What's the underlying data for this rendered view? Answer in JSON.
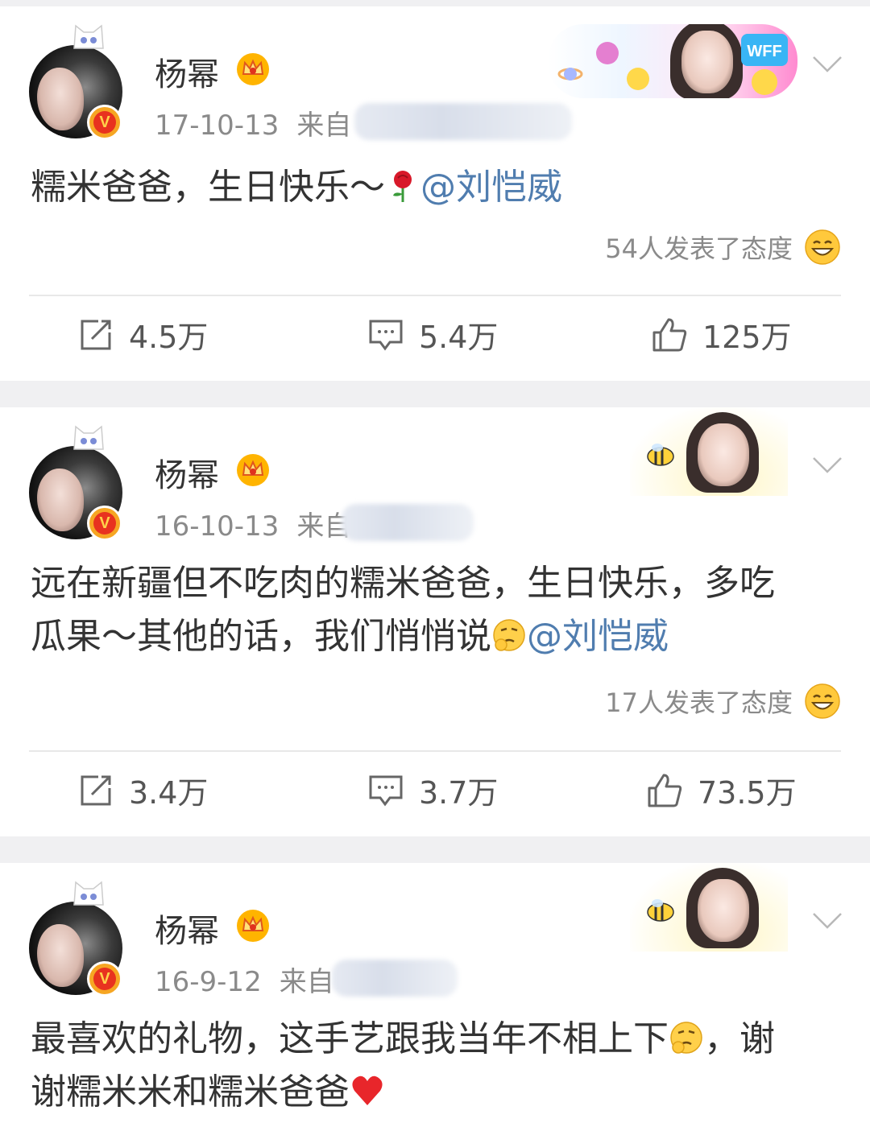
{
  "posts": [
    {
      "username": "杨幂",
      "date": "17-10-13",
      "source_prefix": "来自",
      "content_text": "糯米爸爸，生日快乐～",
      "mention": "@刘恺威",
      "reactions": "54人发表了态度",
      "reposts": "4.5万",
      "comments": "5.4万",
      "likes": "125万",
      "banner_badge": "WFF"
    },
    {
      "username": "杨幂",
      "date": "16-10-13",
      "source_prefix": "来自",
      "content_line1": "远在新疆但不吃肉的糯米爸爸，生日快乐，多吃",
      "content_line2": "瓜果～其他的话，我们悄悄说",
      "mention": "@刘恺威",
      "reactions": "17人发表了态度",
      "reposts": "3.4万",
      "comments": "3.7万",
      "likes": "73.5万"
    },
    {
      "username": "杨幂",
      "date": "16-9-12",
      "source_prefix": "来自",
      "content_line1a": "最喜欢的礼物，这手艺跟我当年不相上下",
      "content_line1b": "，谢",
      "content_line2": "谢糯米米和糯米爸爸"
    }
  ],
  "colors": {
    "mention": "#507daf",
    "vip_badge": "#f6a623",
    "page_bg": "#f0f0f2"
  },
  "icons": [
    "cat-ears-icon",
    "verified-v-icon",
    "crown-icon",
    "chevron-down-icon",
    "rose-icon",
    "thinking-emoji-icon",
    "grin-emoji-icon",
    "heart-icon",
    "repost-icon",
    "comment-icon",
    "like-icon"
  ]
}
